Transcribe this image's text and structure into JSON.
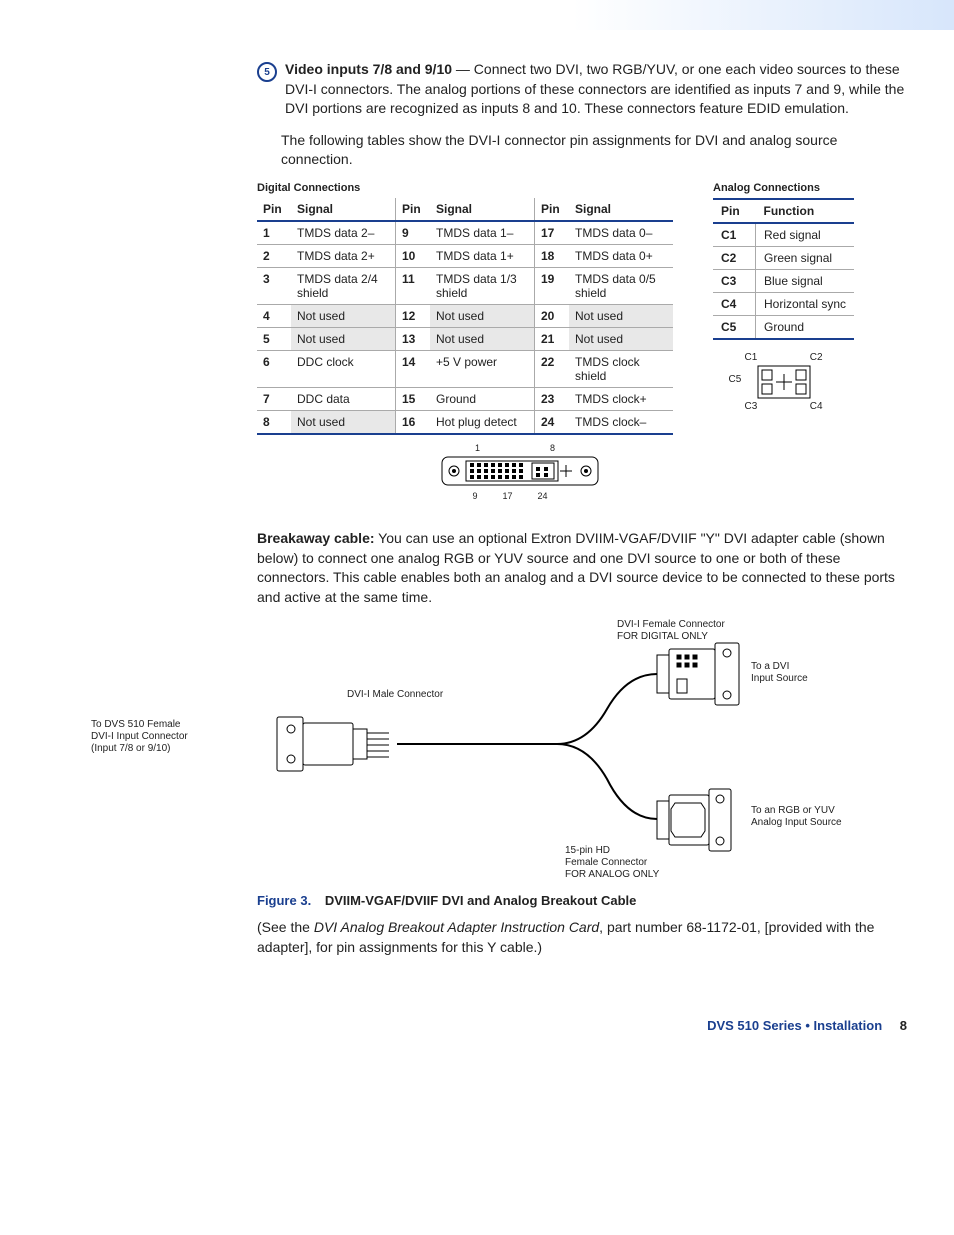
{
  "step": {
    "number": "5",
    "title": "Video inputs 7/8 and 9/10",
    "text": " — Connect two DVI, two RGB/YUV, or one each video sources to these DVI-I connectors. The analog portions of these connectors are identified as inputs 7 and 9, while the DVI portions are recognized as inputs 8 and 10. These connectors feature EDID emulation."
  },
  "paragraph2": "The following tables show the DVI-I connector pin assignments for DVI and analog source connection.",
  "digital_table": {
    "title": "Digital Connections",
    "headers": {
      "pin": "Pin",
      "signal": "Signal"
    },
    "rows": [
      {
        "pinA": "1",
        "sigA": "TMDS data 2–",
        "pinB": "9",
        "sigB": "TMDS data 1–",
        "pinC": "17",
        "sigC": "TMDS data 0–",
        "shade": false
      },
      {
        "pinA": "2",
        "sigA": "TMDS data 2+",
        "pinB": "10",
        "sigB": "TMDS data 1+",
        "pinC": "18",
        "sigC": "TMDS data 0+",
        "shade": false
      },
      {
        "pinA": "3",
        "sigA": "TMDS data 2/4 shield",
        "pinB": "11",
        "sigB": "TMDS data 1/3 shield",
        "pinC": "19",
        "sigC": "TMDS data 0/5 shield",
        "shade": false
      },
      {
        "pinA": "4",
        "sigA": "Not used",
        "pinB": "12",
        "sigB": "Not used",
        "pinC": "20",
        "sigC": "Not used",
        "shade": true
      },
      {
        "pinA": "5",
        "sigA": "Not used",
        "pinB": "13",
        "sigB": "Not used",
        "pinC": "21",
        "sigC": "Not used",
        "shade": true
      },
      {
        "pinA": "6",
        "sigA": "DDC clock",
        "pinB": "14",
        "sigB": "+5 V power",
        "pinC": "22",
        "sigC": "TMDS clock shield",
        "shade": false
      },
      {
        "pinA": "7",
        "sigA": "DDC data",
        "pinB": "15",
        "sigB": "Ground",
        "pinC": "23",
        "sigC": "TMDS clock+",
        "shade": false
      },
      {
        "pinA": "8",
        "sigA": "Not used",
        "pinB": "16",
        "sigB": "Hot plug detect",
        "pinC": "24",
        "sigC": "TMDS clock–",
        "shade8": true
      }
    ]
  },
  "analog_table": {
    "title": "Analog Connections",
    "headers": {
      "pin": "Pin",
      "function": "Function"
    },
    "rows": [
      {
        "pin": "C1",
        "func": "Red signal"
      },
      {
        "pin": "C2",
        "func": "Green signal"
      },
      {
        "pin": "C3",
        "func": "Blue signal"
      },
      {
        "pin": "C4",
        "func": "Horizontal sync"
      },
      {
        "pin": "C5",
        "func": "Ground"
      }
    ]
  },
  "analog_diagram_labels": {
    "c1": "C1",
    "c2": "C2",
    "c3": "C3",
    "c4": "C4",
    "c5": "C5"
  },
  "dvi_plug_labels": {
    "l1": "1",
    "l8": "8",
    "l9": "9",
    "l17": "17",
    "l24": "24"
  },
  "breakaway": {
    "bold": "Breakaway cable:",
    "text": " You can use an optional Extron DVIIM-VGAF/DVIIF \"Y\" DVI adapter cable (shown below) to connect one analog RGB or YUV source and one DVI source to one or both of these connectors. This cable enables both an analog and a DVI source device to be connected to these ports and active at the same time."
  },
  "cable_labels": {
    "left": "To DVS 510 Female\nDVI-I Input Connector\n(Input 7/8 or 9/10)",
    "male": "DVI-I Male Connector",
    "top_right_a": "DVI-I Female Connector",
    "top_right_b": "FOR DIGITAL ONLY",
    "right_top": "To a DVI\nInput Source",
    "right_bot": "To an RGB or YUV\nAnalog Input Source",
    "bot_mid_a": "15-pin HD",
    "bot_mid_b": "Female Connector",
    "bot_mid_c": "FOR ANALOG ONLY"
  },
  "figure": {
    "num": "Figure 3.",
    "title": "DVIIM-VGAF/DVIIF DVI and Analog Breakout Cable"
  },
  "final_para": {
    "pre": "(See the ",
    "italic": "DVI Analog Breakout Adapter Instruction Card",
    "post": ", part number 68-1172-01, [provided with the adapter], for pin assignments for this Y cable.)"
  },
  "footer": {
    "text": "DVS 510 Series • Installation",
    "page": "8"
  }
}
